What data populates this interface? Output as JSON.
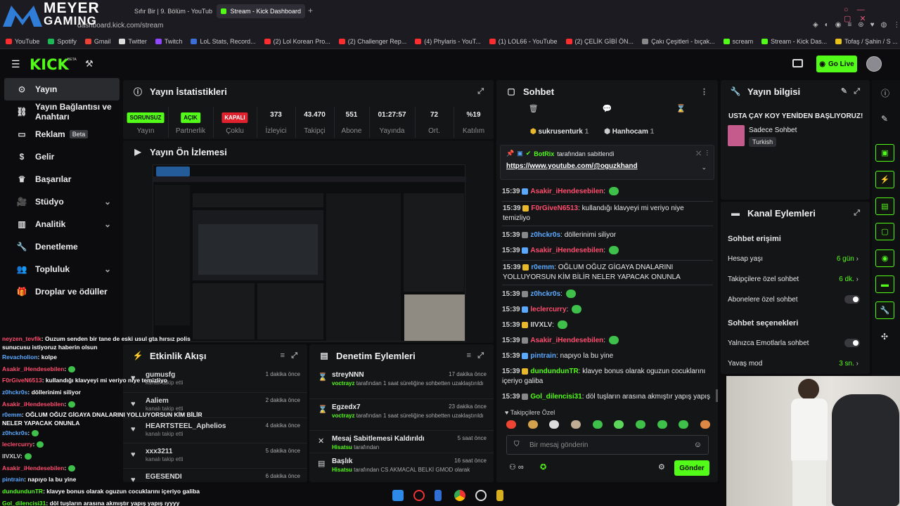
{
  "browser": {
    "tabs": [
      {
        "label": "Sıfır Bir | 9. Bölüm - YouTube"
      },
      {
        "label": "Stream - Kick Dashboard"
      }
    ],
    "new_tab": "+",
    "url": "dashboard.kick.com/stream",
    "bookmarks": [
      "YouTube",
      "Spotify",
      "Gmail",
      "Twitter",
      "Twitch",
      "LoL Stats, Record...",
      "(2) Lol Korean Pro...",
      "(2) Challenger Rep...",
      "(4) Phylaris - YouT...",
      "(1) LOL66 - YouTube",
      "(2) ÇELİK GİBİ ÖN...",
      "Çakı Çeşitleri - bıçak...",
      "scream",
      "Stream - Kick Das...",
      "Tofaş / Şahin / S ..."
    ]
  },
  "overlay_logo": {
    "line1": "MEYER",
    "line2": "GAMING"
  },
  "kick": {
    "logo": "KICK",
    "logo_sup": "BETA",
    "go_live": "Go Live",
    "nav": [
      {
        "label": "Yayın"
      },
      {
        "label": "Yayın Bağlantısı ve Anahtarı"
      },
      {
        "label": "Reklam",
        "badge": "Beta"
      },
      {
        "label": "Gelir"
      },
      {
        "label": "Başarılar"
      },
      {
        "label": "Stüdyo"
      },
      {
        "label": "Analitik"
      },
      {
        "label": "Denetleme"
      },
      {
        "label": "Topluluk"
      },
      {
        "label": "Droplar ve ödüller"
      }
    ]
  },
  "stats_panel": {
    "title": "Yayın İstatistikleri",
    "items": [
      {
        "value": "SORUNSUZ",
        "label": "Yayın"
      },
      {
        "value": "AÇIK",
        "label": "Partnerlik"
      },
      {
        "value": "KAPALI",
        "label": "Çoklu"
      },
      {
        "value": "373",
        "label": "İzleyici"
      },
      {
        "value": "43.470",
        "label": "Takipçi"
      },
      {
        "value": "551",
        "label": "Abone"
      },
      {
        "value": "01:27:57",
        "label": "Yayında"
      },
      {
        "value": "72",
        "label": "Ort."
      },
      {
        "value": "%19",
        "label": "Katılım"
      }
    ]
  },
  "preview_panel": {
    "title": "Yayın Ön İzlemesi"
  },
  "activity_panel": {
    "title": "Etkinlik Akışı",
    "items": [
      {
        "name": "gumusfg",
        "sub": "kanalı takip etti",
        "time": "1 dakika önce"
      },
      {
        "name": "Aaliem",
        "sub": "kanalı takip etti",
        "time": "2 dakika önce"
      },
      {
        "name": "HEARTSTEEL_Aphelios",
        "sub": "kanalı takip etti",
        "time": "4 dakika önce"
      },
      {
        "name": "xxx3211",
        "sub": "kanalı takip etti",
        "time": "5 dakika önce"
      },
      {
        "name": "EGESENDI",
        "sub": "",
        "time": "6 dakika önce"
      }
    ]
  },
  "moderation_panel": {
    "title": "Denetim Eylemleri",
    "items": [
      {
        "title": "streyNNN",
        "mod": "voctrayz",
        "text": "tarafından 1 saat süreliğine sohbetten uzaklaştırıldı",
        "time": "17 dakika önce"
      },
      {
        "title": "Egzedx7",
        "mod": "voctrayz",
        "text": "tarafından 1 saat süreliğine sohbetten uzaklaştırıldı",
        "time": "23 dakika önce"
      },
      {
        "title": "Mesaj Sabitlemesi Kaldırıldı",
        "mod": "Hisatsu",
        "text": "tarafından",
        "time": "5 saat önce"
      },
      {
        "title": "Başlık",
        "mod": "Hisatsu",
        "text": "tarafından CS AKMACAL BELKİ GMOD olarak",
        "time": "16 saat önce"
      }
    ]
  },
  "chat_panel": {
    "title": "Sohbet",
    "top_users": [
      {
        "name": "sukrusenturk",
        "count": "1"
      },
      {
        "name": "Hanhocam",
        "count": "1"
      }
    ],
    "pinned_by": "BotRix",
    "pinned_suffix": "tarafından sabitlendi",
    "pinned_link": "https://www.youtube.com/@oguzkhand",
    "messages": [
      {
        "time": "15:39",
        "user": "Asakir_iHendesebilen",
        "color": "#ff4d6d",
        "text": "",
        "emote": true
      },
      {
        "time": "15:39",
        "user": "F0rGiveN6513",
        "color": "#ff4d6d",
        "text": "kullandığı klavyeyi mi veriyo niye temizliyo",
        "emote": false,
        "box": true
      },
      {
        "time": "15:39",
        "user": "z0hckr0s",
        "color": "#5aa9ff",
        "text": "döllerinimi siliyor",
        "emote": false
      },
      {
        "time": "15:39",
        "user": "Asakir_iHendesebilen",
        "color": "#ff4d6d",
        "text": "",
        "emote": true
      },
      {
        "time": "15:39",
        "user": "r0emm",
        "color": "#5aa9ff",
        "text": "OĞLUM OĞUZ GİGAYA DNALARINI YOLLUYORSUN KİM BİLİR NELER YAPACAK ONUNLA",
        "emote": false,
        "box": true
      },
      {
        "time": "15:39",
        "user": "z0hckr0s",
        "color": "#5aa9ff",
        "text": "",
        "emote": true
      },
      {
        "time": "15:39",
        "user": "leclercurry",
        "color": "#ff4d6d",
        "text": "",
        "emote": true
      },
      {
        "time": "15:39",
        "user": "IIVXLV",
        "color": "#cfcfcf",
        "text": "",
        "emote": true
      },
      {
        "time": "15:39",
        "user": "Asakir_iHendesebilen",
        "color": "#ff4d6d",
        "text": "",
        "emote": true
      },
      {
        "time": "15:39",
        "user": "pintrain",
        "color": "#5aa9ff",
        "text": "napıyo la bu yine",
        "emote": false
      },
      {
        "time": "15:39",
        "user": "dundundunTR",
        "color": "#53fc18",
        "text": "klavye bonus olarak oguzun cocuklarını içeriyo galiba",
        "emote": false
      },
      {
        "time": "15:39",
        "user": "Gol_dilencisi31",
        "color": "#53fc18",
        "text": "döl tuşların arasına akmıştır yapış yapış ıyyyy",
        "emote": false
      }
    ],
    "followers_only": "Takipçilere Özel",
    "input_placeholder": "Bir mesaj gönderin",
    "send": "Gönder",
    "infinity": "∞"
  },
  "stream_info": {
    "title": "Yayın bilgisi",
    "stream_title": "USTA ÇAY KOY YENİDEN BAŞLIYORUZ!",
    "category": "Sadece Sohbet",
    "language": "Turkish"
  },
  "channel_actions": {
    "title": "Kanal Eylemleri",
    "chat_access": "Sohbet erişimi",
    "account_age": {
      "label": "Hesap yaşı",
      "value": "6 gün"
    },
    "followers_chat": {
      "label": "Takipçilere özel sohbet",
      "value": "6 dk."
    },
    "subs_chat": {
      "label": "Abonelere özel sohbet"
    },
    "chat_options": "Sohbet seçenekleri",
    "emote_only": {
      "label": "Yalnızca Emotlarla sohbet"
    },
    "slow_mode": {
      "label": "Yavaş mod",
      "value": "3 sn."
    }
  },
  "overlay_chat": [
    {
      "user": "neyzen_tevfik",
      "color": "#ff4d6d",
      "text": ": Ouzum senden bir tane de eski usul gta hırsız polis sunucusu istiyoruz haberin olsun"
    },
    {
      "user": "Revacholion",
      "color": "#5aa9ff",
      "text": ": kolpe"
    },
    {
      "user": "Asakir_iHendesebilen",
      "color": "#ff4d6d",
      "text": ":"
    },
    {
      "user": "F0rGiveN6513",
      "color": "#ff4d6d",
      "text": ": kullandığı klavyeyi mi veriyo niye temizliyo"
    },
    {
      "user": "z0hckr0s",
      "color": "#5aa9ff",
      "text": ": döllerinimi siliyor"
    },
    {
      "user": "Asakir_iHendesebilen",
      "color": "#ff4d6d",
      "text": ":"
    },
    {
      "user": "r0emm",
      "color": "#5aa9ff",
      "text": ": OĞLUM OĞUZ GİGAYA DNALARINI YOLLUYORSUN KİM BİLİR NELER YAPACAK ONUNLA"
    },
    {
      "user": "z0hckr0s",
      "color": "#5aa9ff",
      "text": ":"
    },
    {
      "user": "leclercurry",
      "color": "#ff4d6d",
      "text": ":"
    },
    {
      "user": "IIVXLV",
      "color": "#cfcfcf",
      "text": ":"
    },
    {
      "user": "Asakir_iHendesebilen",
      "color": "#ff4d6d",
      "text": ":"
    },
    {
      "user": "pintrain",
      "color": "#5aa9ff",
      "text": ": napıyo la bu yine"
    },
    {
      "user": "dundundunTR",
      "color": "#53fc18",
      "text": ": klavye bonus olarak oguzun cocuklarını içeriyo galiba"
    },
    {
      "user": "Gol_dilencisi31",
      "color": "#53fc18",
      "text": ": döl tuşların arasına akmıştır yapış yapış ıyyyy"
    }
  ],
  "colors": {
    "accent": "#53fc18",
    "bg": "#0c0c0e",
    "panel": "#141517",
    "pink": "#ff4d6d",
    "blue": "#5aa9ff"
  }
}
